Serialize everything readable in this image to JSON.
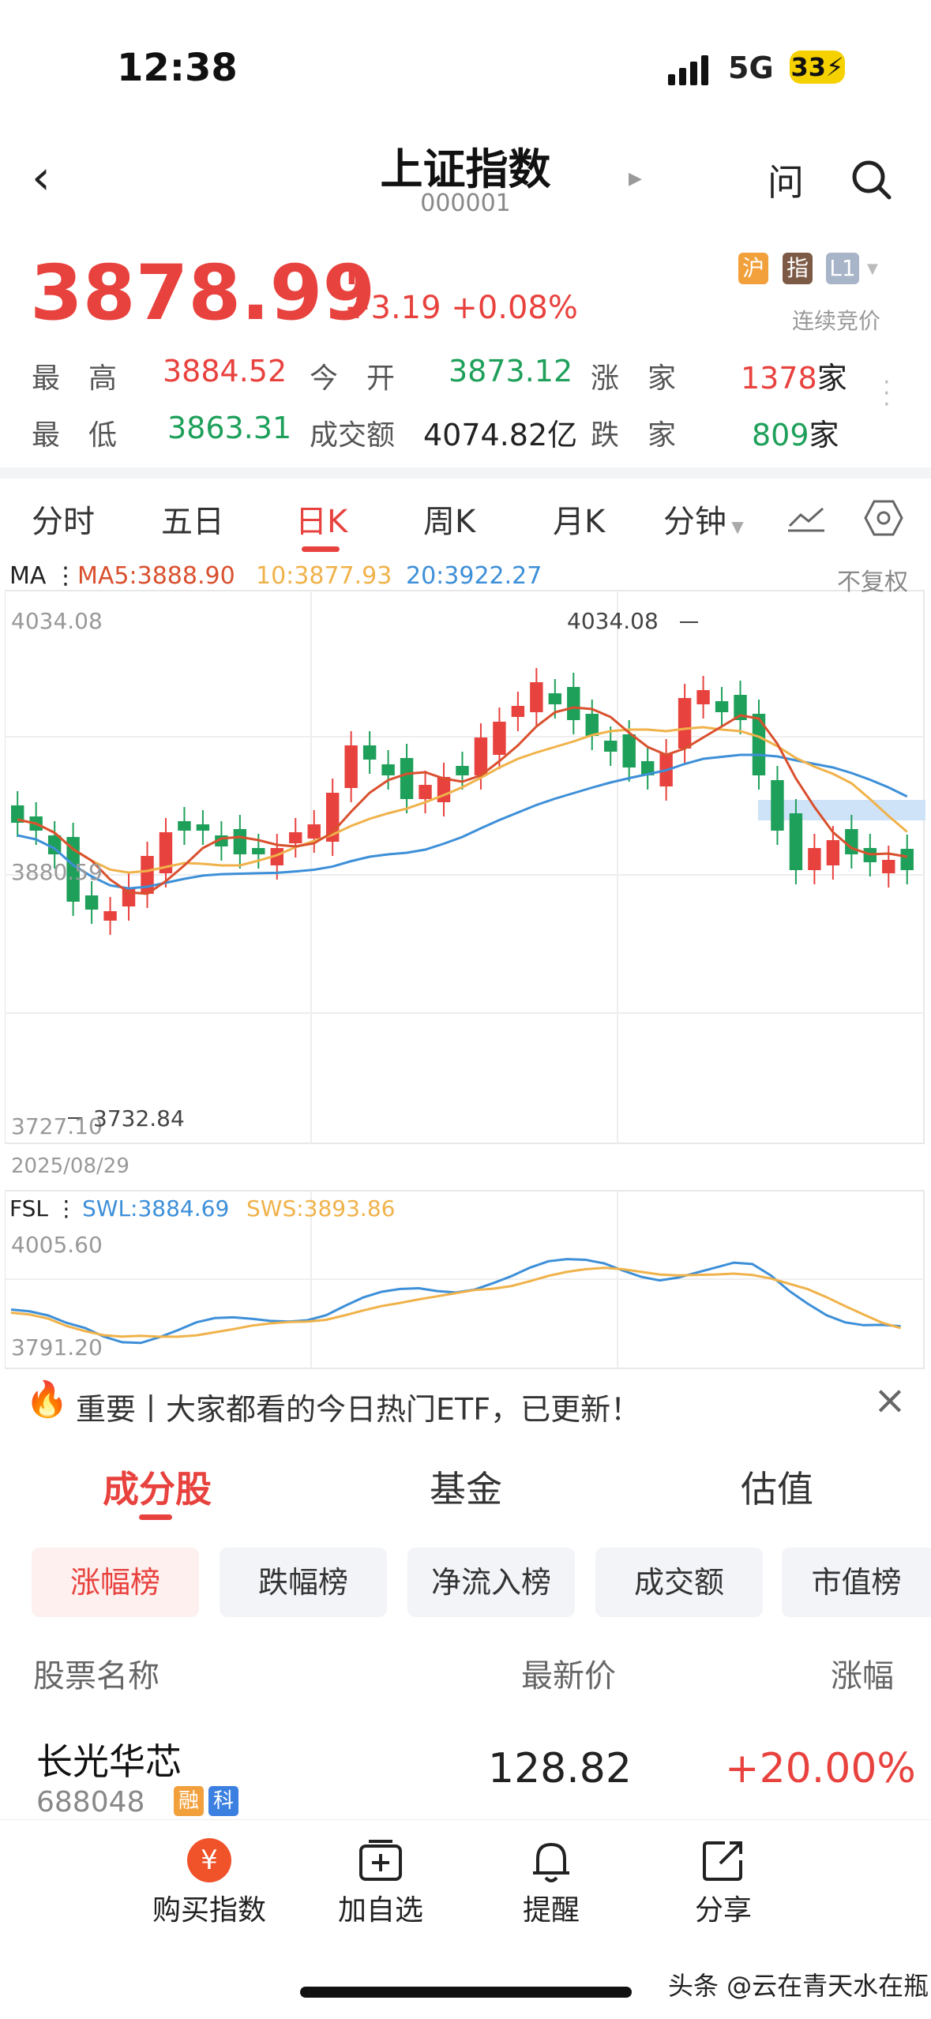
{
  "status": {
    "time": "12:38",
    "network": "5G",
    "battery": "33"
  },
  "header": {
    "title": "上证指数",
    "code": "000001",
    "ask_label": "问"
  },
  "quote": {
    "price": "3878.99",
    "change": "+3.19",
    "change_pct": "+0.08%",
    "tags": [
      "沪",
      "指",
      "L1"
    ],
    "auction_label": "连续竞价"
  },
  "stats": {
    "high_label": "最　高",
    "high": "3884.52",
    "open_label": "今　开",
    "open": "3873.12",
    "up_label": "涨　家",
    "up": "1378",
    "up_unit": "家",
    "low_label": "最　低",
    "low": "3863.31",
    "vol_label": "成交额",
    "vol": "4074.82亿",
    "down_label": "跌　家",
    "down": "809",
    "down_unit": "家"
  },
  "period_tabs": [
    "分时",
    "五日",
    "日K",
    "周K",
    "月K",
    "分钟"
  ],
  "chart": {
    "ma_label": "MA",
    "ma5": "MA5:3888.90",
    "ma10": "10:3877.93",
    "ma20": "20:3922.27",
    "fq_label": "不复权",
    "y_top": "4034.08",
    "y_mid": "3880.59",
    "y_bot": "3727.10",
    "high_mark": "4034.08",
    "low_mark": "3732.84",
    "date": "2025/08/29",
    "fsl_label": "FSL",
    "swl": "SWL:3884.69",
    "sws": "SWS:3893.86",
    "fsl_top": "4005.60",
    "fsl_bot": "3791.20",
    "colors": {
      "up": "#e8423e",
      "down": "#1ea05a",
      "ma5": "#d9502e",
      "ma10": "#f0b24a",
      "ma20": "#3d8fd8"
    }
  },
  "tip": {
    "text": "重要丨大家都看的今日热门ETF，已更新！"
  },
  "section_tabs": [
    "成分股",
    "基金",
    "估值"
  ],
  "rank_pills": [
    "涨幅榜",
    "跌幅榜",
    "净流入榜",
    "成交额",
    "市值榜"
  ],
  "table": {
    "headers": [
      "股票名称",
      "最新价",
      "涨幅"
    ],
    "rows": [
      {
        "name": "长光华芯",
        "code": "688048",
        "badges": [
          "融",
          "科"
        ],
        "price": "128.82",
        "change": "+20.00%"
      }
    ]
  },
  "bottom": {
    "items": [
      "购买指数",
      "加自选",
      "提醒",
      "分享"
    ],
    "buy_icon": "¥"
  },
  "watermark": "头条 @云在青天水在瓶"
}
